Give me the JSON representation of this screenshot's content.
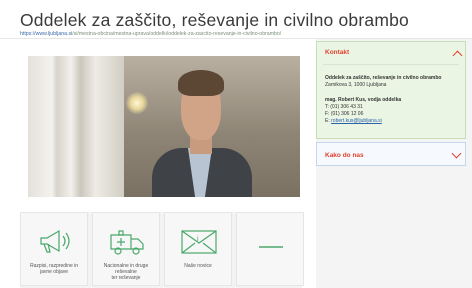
{
  "header": {
    "title": "Oddelek za zaščito, reševanje in civilno obrambo",
    "url_host": "https://www.ljubljana.si",
    "url_path": "/si/mestna-obcina/mestna-uprava/oddelki/oddelek-za-zascito-resevanje-in-civilno-obrambo/"
  },
  "tiles": [
    {
      "label_line1": "Razpisi, razpredine in",
      "label_line2": "javne objave",
      "icon": "megaphone-icon"
    },
    {
      "label_line1": "Nacionalne in druge reševalne",
      "label_line2": "ter reševanje",
      "icon": "ambulance-icon"
    },
    {
      "label_line1": "Naše novice",
      "label_line2": "",
      "icon": "envelope-icon"
    },
    {
      "label_line1": "",
      "label_line2": "",
      "icon": "dash-icon"
    }
  ],
  "sidebar": {
    "kontakt": {
      "heading": "Kontakt",
      "org_name": "Oddelek za zaščito, reševanje in civilno obrambo",
      "address": "Zarnikova 3, 1000 Ljubljana",
      "head_name": "mag. Robert Kus, vodja oddelka",
      "phone1": "T: (01) 306 43 31",
      "phone2": "F: (01) 306 12 06",
      "email_prefix": "E:",
      "email": "robert.kus@ljubljana.si"
    },
    "kako": {
      "heading": "Kako do nas"
    }
  },
  "colors": {
    "accent": "#e2402f",
    "icon_green": "#4aa86b",
    "kontakt_bg": "#eaf5e3"
  }
}
